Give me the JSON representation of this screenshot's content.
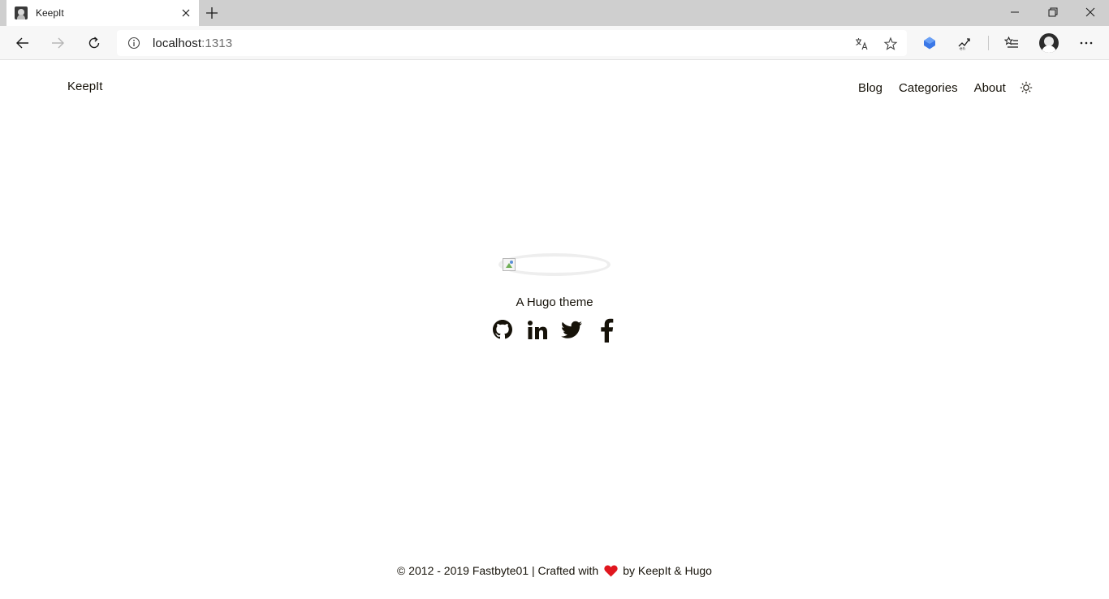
{
  "browser": {
    "tab": {
      "title": "KeepIt"
    },
    "address": {
      "host": "localhost",
      "port": ":1313"
    }
  },
  "site": {
    "logo": "KeepIt",
    "nav": [
      {
        "label": "Blog"
      },
      {
        "label": "Categories"
      },
      {
        "label": "About"
      }
    ],
    "subtitle": "A Hugo theme",
    "social_icons": [
      "github-icon",
      "linkedin-icon",
      "twitter-icon",
      "facebook-icon"
    ],
    "footer": {
      "copyright": "© 2012 - 2019 Fastbyte01 | Crafted with",
      "heart_color": "#e0161e",
      "suffix": "by KeepIt & Hugo"
    }
  },
  "colors": {
    "text": "#161209",
    "tabbar_bg": "#cfcfcf",
    "toolbar_bg": "#f7f7f7",
    "accent_blue": "#3b78e7"
  }
}
